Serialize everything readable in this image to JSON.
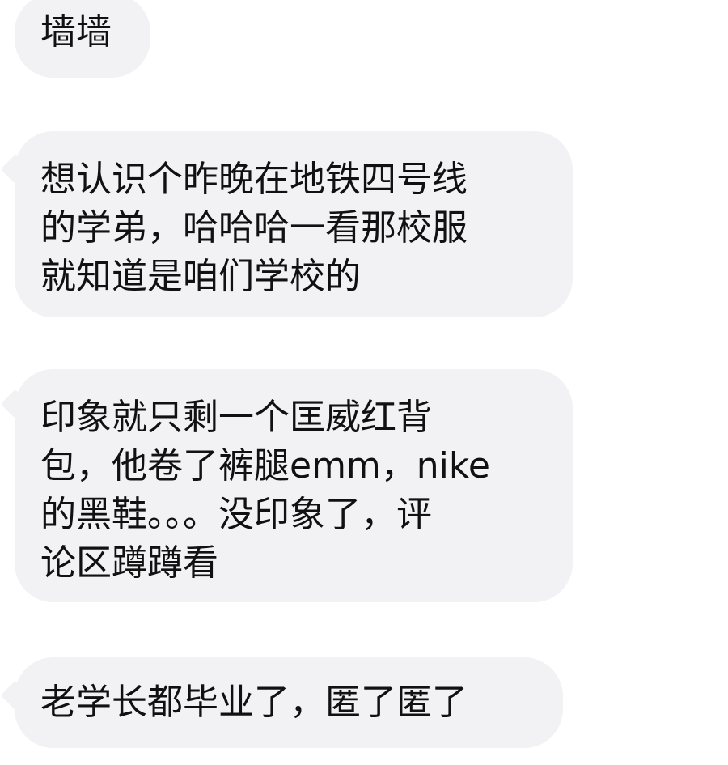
{
  "messages": [
    {
      "lines": [
        "墙墙"
      ]
    },
    {
      "lines": [
        "想认识个昨晚在地铁四号线",
        "的学弟，哈哈哈一看那校服",
        "就知道是咱们学校的"
      ]
    },
    {
      "lines": [
        "印象就只剩一个匡威红背",
        "包，他卷了裤腿emm，nike",
        "的黑鞋。。。没印象了，评",
        "论区蹲蹲看"
      ]
    },
    {
      "lines": [
        "老学长都毕业了，匿了匿了"
      ]
    }
  ]
}
